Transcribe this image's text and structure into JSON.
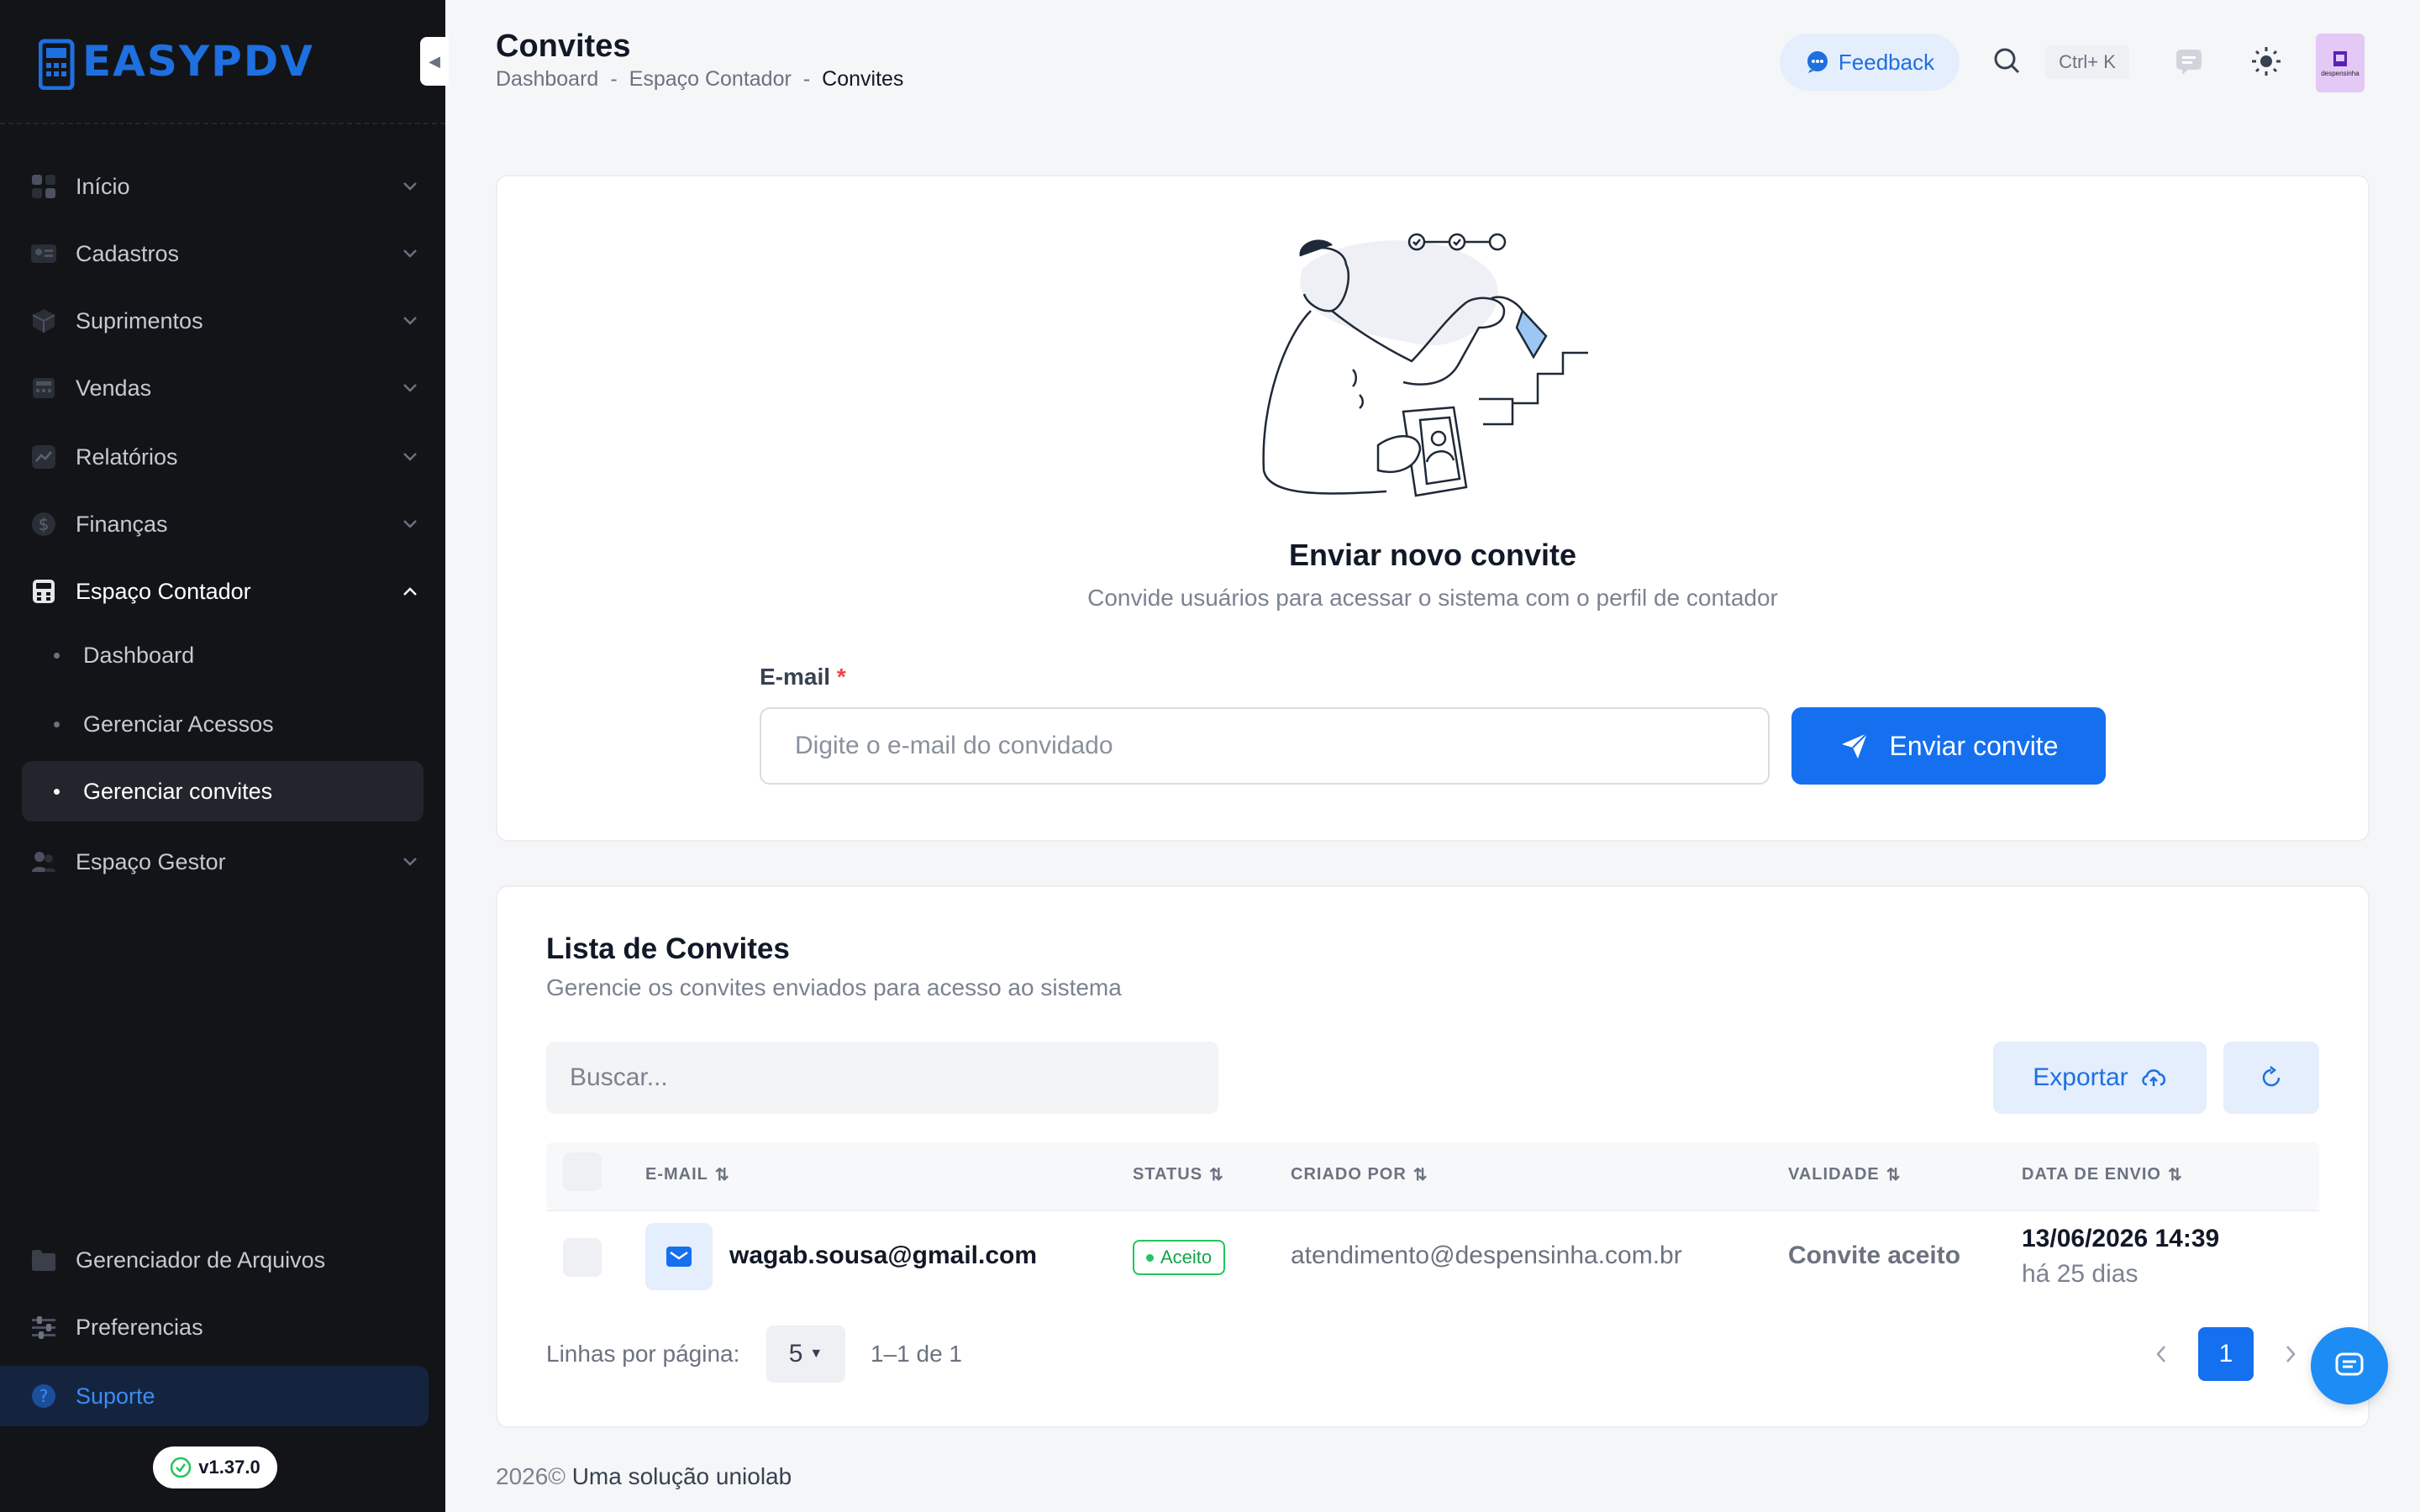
{
  "app": {
    "logo_text": "EASYPDV",
    "version": "v1.37.0"
  },
  "sidebar": {
    "items": [
      {
        "label": "Início",
        "icon": "grid-icon"
      },
      {
        "label": "Cadastros",
        "icon": "id-card-icon"
      },
      {
        "label": "Suprimentos",
        "icon": "box-icon"
      },
      {
        "label": "Vendas",
        "icon": "register-icon"
      },
      {
        "label": "Relatórios",
        "icon": "chart-line-icon"
      },
      {
        "label": "Finanças",
        "icon": "dollar-icon"
      },
      {
        "label": "Espaço Contador",
        "icon": "calculator-icon"
      },
      {
        "label": "Espaço Gestor",
        "icon": "people-icon"
      }
    ],
    "sub_items": [
      {
        "label": "Dashboard"
      },
      {
        "label": "Gerenciar Acessos"
      },
      {
        "label": "Gerenciar convites"
      }
    ],
    "bottom_items": [
      {
        "label": "Gerenciador de Arquivos",
        "icon": "folder-icon"
      },
      {
        "label": "Preferencias",
        "icon": "sliders-icon"
      },
      {
        "label": "Suporte",
        "icon": "help-icon"
      }
    ]
  },
  "header": {
    "title": "Convites",
    "breadcrumb": [
      "Dashboard",
      "Espaço Contador",
      "Convites"
    ],
    "feedback_label": "Feedback",
    "shortcut": "Ctrl+ K",
    "avatar_text": "despensinha"
  },
  "invite": {
    "title": "Enviar novo convite",
    "subtitle": "Convide usuários para acessar o sistema com o perfil de contador",
    "email_label": "E-mail",
    "required_mark": "*",
    "email_placeholder": "Digite o e-mail do convidado",
    "send_label": "Enviar convite"
  },
  "list": {
    "title": "Lista de Convites",
    "subtitle": "Gerencie os convites enviados para acesso ao sistema",
    "search_placeholder": "Buscar...",
    "export_label": "Exportar",
    "columns": [
      "E-MAIL",
      "STATUS",
      "CRIADO POR",
      "VALIDADE",
      "DATA DE ENVIO"
    ],
    "rows": [
      {
        "email": "wagab.sousa@gmail.com",
        "status": "Aceito",
        "created_by": "atendimento@despensinha.com.br",
        "validity": "Convite aceito",
        "sent_date": "13/06/2026 14:39",
        "sent_relative": "há 25 dias"
      }
    ],
    "rows_per_page_label": "Linhas por página:",
    "rows_per_page": "5",
    "range": "1–1 de 1",
    "current_page": "1"
  },
  "footer": {
    "year": "2026©",
    "brand": "Uma solução uniolab"
  },
  "colors": {
    "sidebar_bg": "#121418",
    "accent": "#1570ef",
    "success": "#22c55e"
  }
}
